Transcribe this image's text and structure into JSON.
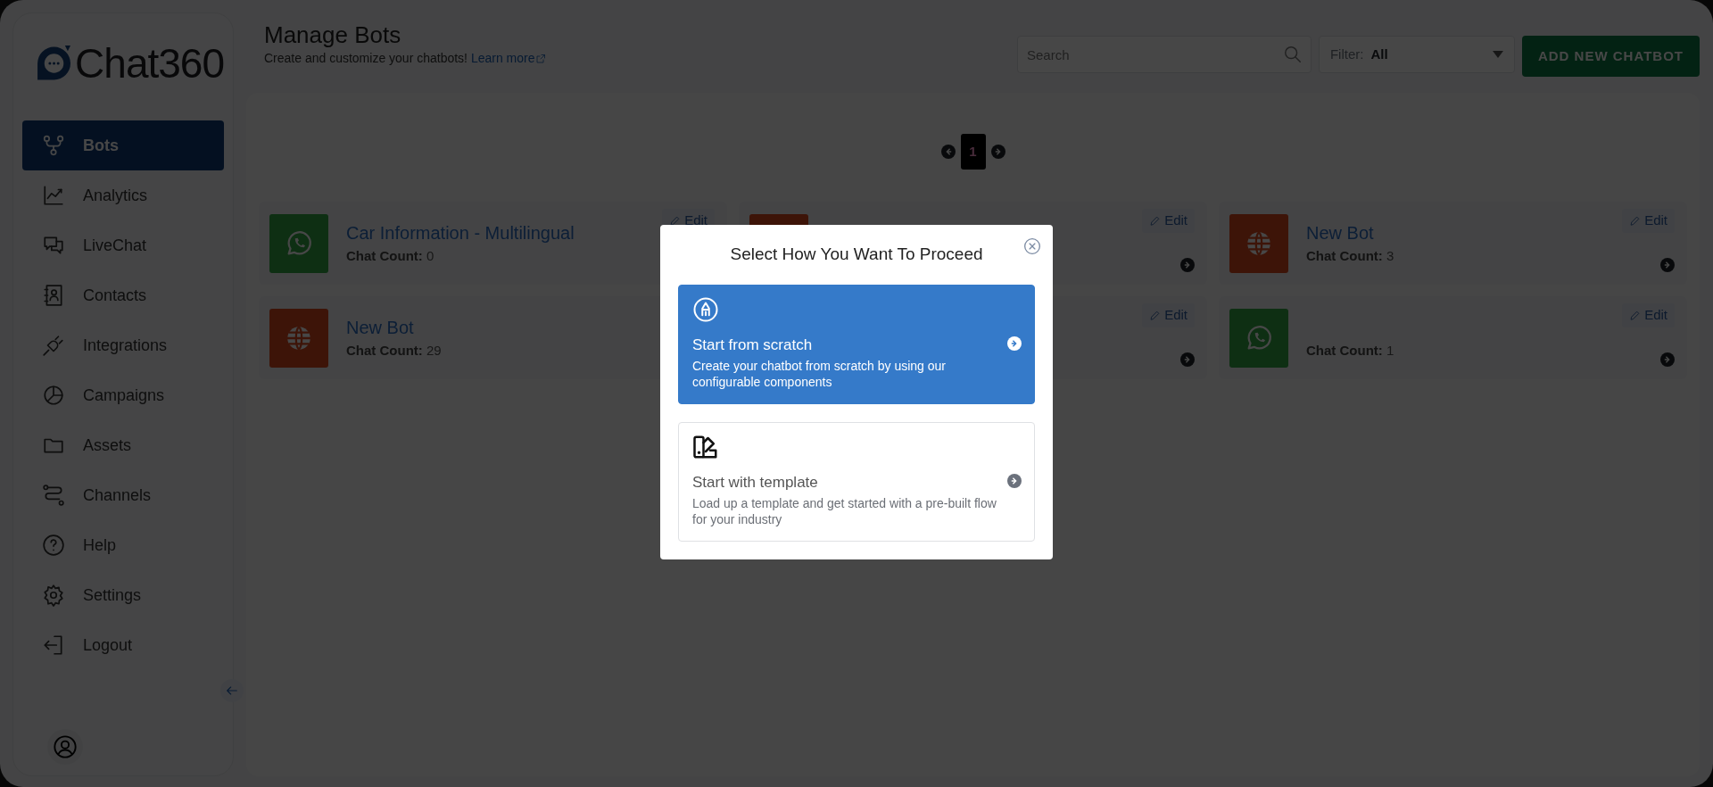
{
  "sidebar": {
    "logo": {
      "text": "Chat",
      "number": "360"
    },
    "items": [
      {
        "label": "Bots",
        "selected": true
      },
      {
        "label": "Analytics",
        "selected": false
      },
      {
        "label": "LiveChat",
        "selected": false
      },
      {
        "label": "Contacts",
        "selected": false
      },
      {
        "label": "Integrations",
        "selected": false
      },
      {
        "label": "Campaigns",
        "selected": false
      },
      {
        "label": "Assets",
        "selected": false
      },
      {
        "label": "Channels",
        "selected": false
      },
      {
        "label": "Help",
        "selected": false
      },
      {
        "label": "Settings",
        "selected": false
      },
      {
        "label": "Logout",
        "selected": false
      }
    ]
  },
  "header": {
    "title": "Manage Bots",
    "subtitle": "Create and customize your chatbots!",
    "link": "Learn more",
    "search": {
      "placeholder": "Search"
    },
    "filter": {
      "label": "Filter:",
      "value": "All"
    },
    "add_button": "ADD NEW CHATBOT"
  },
  "pagination": {
    "pages": [
      {
        "label": "1",
        "selected": true
      }
    ]
  },
  "bots": [
    {
      "kind": "whatsapp",
      "name": "Car Information - Multilingual",
      "count_label": "Chat Count:",
      "count": "0",
      "edit": "Edit"
    },
    {
      "kind": "web",
      "edit": "Edit"
    },
    {
      "kind": "web",
      "name": "New Bot",
      "count_label": "Chat Count:",
      "count": "3",
      "edit": "Edit"
    },
    {
      "kind": "web",
      "name": "New Bot",
      "count_label": "Chat Count:",
      "count": "29"
    },
    {
      "edit": "Edit"
    },
    {
      "kind": "whatsapp",
      "count_label": "Chat Count:",
      "count": "1",
      "edit": "Edit"
    }
  ],
  "modal": {
    "title": "Select How You Want To Proceed",
    "options": [
      {
        "kind": "scratch",
        "title": "Start from scratch",
        "description": "Create your chatbot from scratch by using our configurable components",
        "selected": true
      },
      {
        "kind": "template",
        "title": "Start with template",
        "description": "Load up a template and get started with a pre-built flow for your industry",
        "selected": false
      }
    ]
  }
}
